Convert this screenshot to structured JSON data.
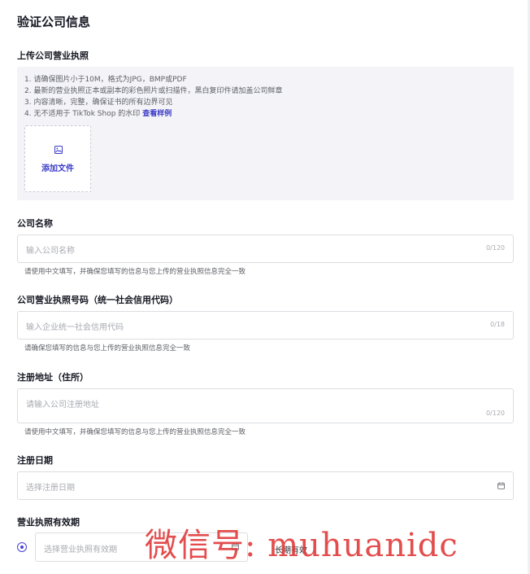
{
  "title": "验证公司信息",
  "upload": {
    "label": "上传公司营业执照",
    "instructions": [
      "1. 请确保图片小于10M，格式为JPG，BMP或PDF",
      "2. 最新的营业执照正本或副本的彩色照片或扫描件，黑白复印件请加盖公司鲜章",
      "3. 内容清晰，完整，确保证书的所有边界可见",
      "4. 无不适用于 TikTok Shop 的水印"
    ],
    "example_link": "查看样例",
    "add_file": "添加文件"
  },
  "company_name": {
    "label": "公司名称",
    "placeholder": "输入公司名称",
    "counter": "0/120",
    "hint": "请使用中文填写，并确保您填写的信息与您上传的营业执照信息完全一致"
  },
  "license_number": {
    "label": "公司营业执照号码（统一社会信用代码）",
    "placeholder": "输入企业统一社会信用代码",
    "counter": "0/18",
    "hint": "请确保您填写的信息与您上传的营业执照信息完全一致"
  },
  "address": {
    "label": "注册地址（住所）",
    "placeholder": "请输入公司注册地址",
    "counter": "0/120",
    "hint": "请使用中文填写，并确保您填写的信息与您上传的营业执照信息完全一致"
  },
  "reg_date": {
    "label": "注册日期",
    "placeholder": "选择注册日期"
  },
  "validity": {
    "label": "营业执照有效期",
    "placeholder": "选择营业执照有效期",
    "long_valid": "长期有效"
  },
  "watermark": "微信号: muhuanidc",
  "colors": {
    "accent": "#4940d8",
    "link": "#3c3cc8",
    "upload_bg": "#f4f4f8"
  }
}
